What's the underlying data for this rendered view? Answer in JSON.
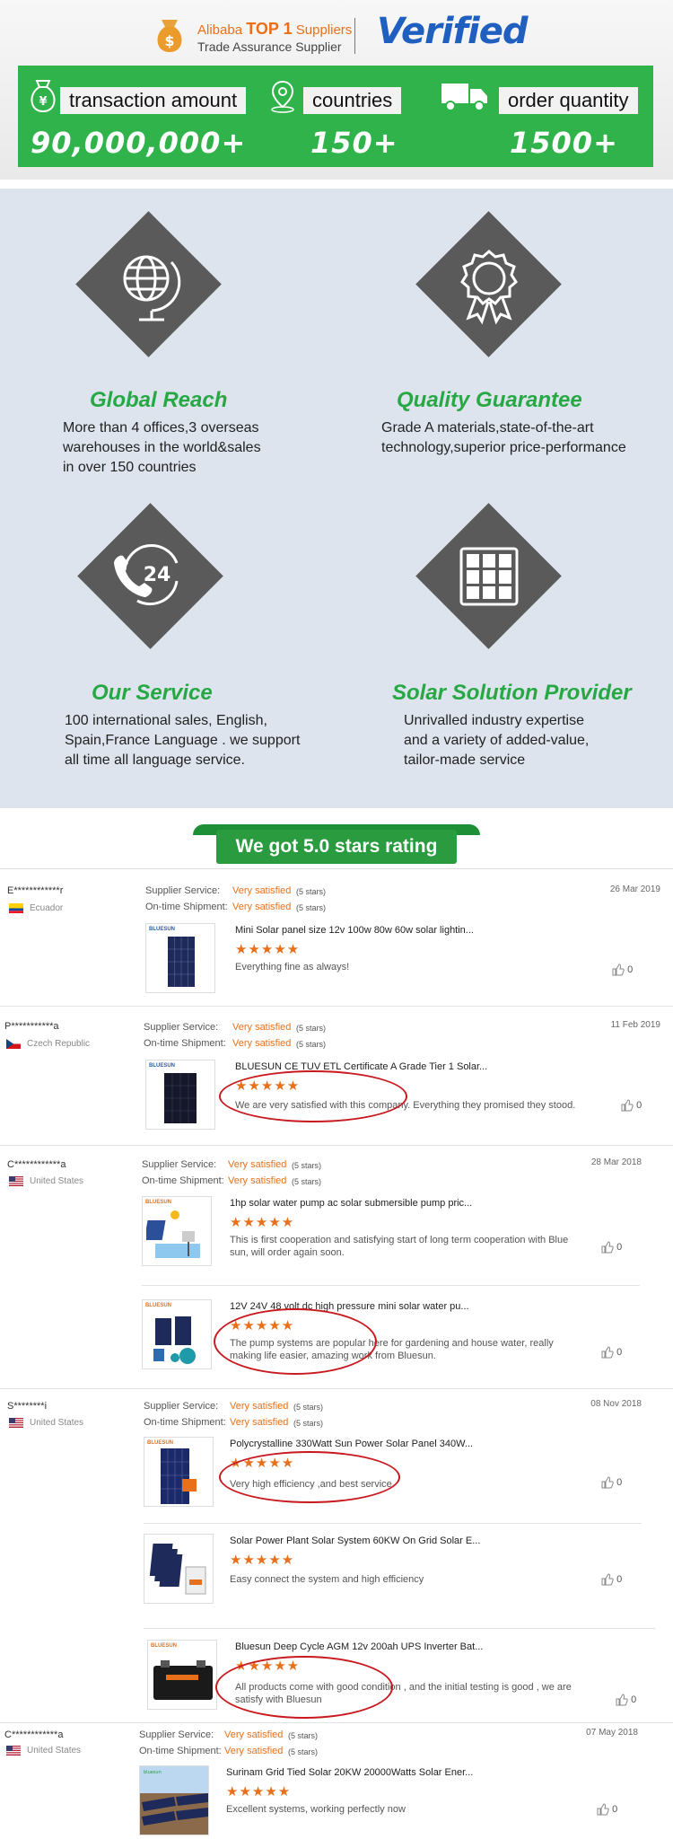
{
  "banner": {
    "alibaba": "Alibaba",
    "top1": "TOP 1",
    "suppliers": "Suppliers",
    "trade_assurance": "Trade Assurance Supplier",
    "verified": "Verified",
    "stats": [
      {
        "label": "transaction amount",
        "value": "90,000,000+",
        "icon": "money-bag-icon"
      },
      {
        "label": "countries",
        "value": "150+",
        "icon": "location-pin-icon"
      },
      {
        "label": "order quantity",
        "value": "1500+",
        "icon": "truck-icon"
      }
    ]
  },
  "features": [
    {
      "title": "Global Reach",
      "desc": "More than 4 offices,3 overseas\nwarehouses in the world&sales\n in over 150 countries",
      "icon": "globe-icon"
    },
    {
      "title": "Quality Guarantee",
      "desc": "Grade A materials,state-of-the-art\ntechnology,superior price-performance",
      "icon": "award-badge-icon"
    },
    {
      "title": "Our Service",
      "desc": "100 international sales, English,\nSpain,France Language . we support\n all time all language service.",
      "icon": "phone-24-icon"
    },
    {
      "title": "Solar Solution Provider",
      "desc": "Unrivalled industry expertise\nand a variety of added-value,\ntailor-made service",
      "icon": "solar-panel-icon"
    }
  ],
  "rating_title": "We got 5.0 stars rating",
  "colors": {
    "green": "#2fb34a",
    "dark_green": "#27a845",
    "orange": "#e8701a",
    "red": "#c8191e",
    "gray": "#5a5a5a"
  },
  "review_labels": {
    "supplier_service": "Supplier Service:",
    "ontime_shipment": "On-time Shipment:",
    "very_satisfied": "Very satisfied",
    "five_stars": "(5 stars)",
    "stars": "★★★★★"
  },
  "reviews": [
    {
      "user": "E************r",
      "country": "Ecuador",
      "date": "26 Mar 2019",
      "items": [
        {
          "title": "Mini Solar panel size 12v 100w 80w 60w solar lightin...",
          "comment": "Everything fine as always!",
          "likes": "0"
        }
      ]
    },
    {
      "user": "P***********a",
      "country": "Czech Republic",
      "date": "11 Feb 2019",
      "items": [
        {
          "title": "BLUESUN CE TUV ETL Certificate A Grade Tier 1 Solar...",
          "comment": "We are very satisfied with this company. Everything they promised they stood.",
          "likes": "0"
        }
      ]
    },
    {
      "user": "C************a",
      "country": "United States",
      "date": "28 Mar 2018",
      "items": [
        {
          "title": "1hp solar water pump ac solar submersible pump pric...",
          "comment": "This is first cooperation and satisfying start of long term cooperation with Blue sun, will order again soon.",
          "likes": "0"
        },
        {
          "title": "12V 24V 48 volt dc high pressure mini solar water pu...",
          "comment": "The pump systems are popular here for gardening and house water, really making life easier, amazing work from Bluesun.",
          "likes": "0"
        }
      ]
    },
    {
      "user": "S********i",
      "country": "United States",
      "date": "08 Nov 2018",
      "items": [
        {
          "title": "Polycrystalline 330Watt Sun Power Solar Panel 340W...",
          "comment": "Very high efficiency ,and best service",
          "likes": "0"
        },
        {
          "title": "Solar Power Plant Solar System 60KW On Grid Solar E...",
          "comment": "Easy connect the system and high efficiency",
          "likes": "0"
        },
        {
          "title": "Bluesun Deep Cycle AGM 12v 200ah UPS Inverter Bat...",
          "comment": "All products come with good condition , and the initial testing is good , we are satisfy with Bluesun",
          "likes": "0"
        }
      ]
    },
    {
      "user": "C************a",
      "country": "United States",
      "date": "07 May 2018",
      "items": [
        {
          "title": "Surinam Grid Tied Solar 20KW 20000Watts Solar Ener...",
          "comment": "Excellent systems, working perfectly now",
          "likes": "0"
        }
      ]
    }
  ],
  "thumb_brand": "BLUESUN"
}
